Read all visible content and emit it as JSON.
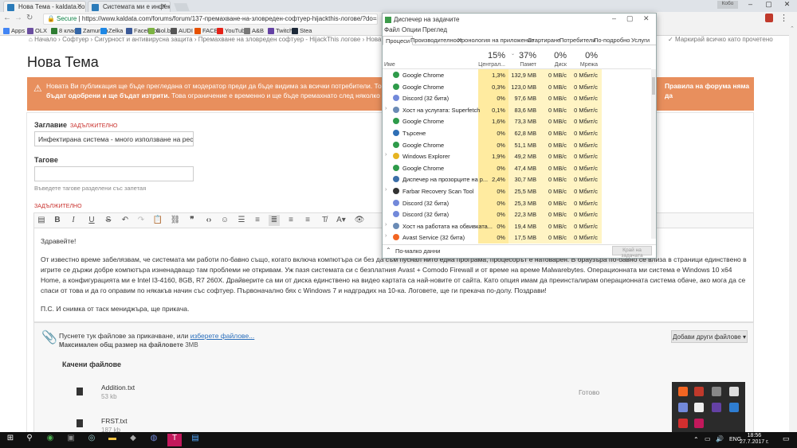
{
  "browser": {
    "tabs": [
      {
        "label": "Нова Тема - kaldata.com"
      },
      {
        "label": "Системата ми е инфекти"
      }
    ],
    "user": "Кобо",
    "secure_label": "Secure",
    "url": "https://www.kaldata.com/forums/forum/137-премахване-на-зловреден-софтуер-hijackthis-логове/?do=add",
    "bookmarks": [
      "Apps",
      "OLX",
      "8 клас",
      "Zamunda",
      "Zelka",
      "Facebook",
      "Gol.bg",
      "AUDI",
      "FACEIT",
      "YouTube",
      "A&B",
      "Twitch",
      "Stea"
    ],
    "bookmark_colors": [
      "#4285f4",
      "#6a4ea0",
      "#2e7d32",
      "#3466a8",
      "#1e88e5",
      "#3b5998",
      "#7cb342",
      "#555555",
      "#e65100",
      "#e62117",
      "#777777",
      "#6441a4",
      "#1b2838"
    ]
  },
  "page": {
    "breadcrumb": [
      "Начало",
      "Софтуер",
      "Сигурност и антивирусна защита",
      "Премахване на зловреден софтуер - HijackThis логове",
      "Нова тема"
    ],
    "mark_all_read": "Маркирай всичко като прочетено",
    "title": "Нова Тема",
    "alert_text": "Новата Ви публикация ще бъде прегледана от модератор преди да бъде видима за всички потребители. Това може да",
    "alert_bold_right": "Правила на форума няма да",
    "alert_bold": "бъдат одобрени и ще бъдат изтрити.",
    "alert_rest": "Това ограничение е временно и ще бъде премахнато след няколко одобрени ваш",
    "title_label": "Заглавие",
    "required": "ЗАДЪЛЖИТЕЛНО",
    "title_value": "Инфектирана система - много използване на ресурс",
    "tags_label": "Тагове",
    "tags_hint": "Въведете тагове разделени със запетая",
    "required2": "ЗАДЪЛЖИТЕЛНО",
    "p1": "Здравейте!",
    "p2": "От известно време забелязвам, че системата ми работи по-бавно същo, когато включа компютъра си без да съм пуснал нито една програма, процесорът е натоварен. В браузъра по-бавно се влиза в страници единствено в игрите се държи добре компютъра изненадващо там проблеми не откривам. Уж пазя системата си с безплатния Avast + Comodo Firewall и от време на време Malwarebytes. Операционната ми система е Windows 10 x64 Home, а конфигурацията ми е Intel I3-4160, 8GB,  R7 260X. Драйверите са ми от диска единствено на видео картата са най-новите от сайта. Като опция имам да преинсталирам операционната система обаче, ако мога да се спаси от това и да го оправим по някакъв начин със софтуер. Първоначално бях с Windows 7 и надградих на 10-ка. Логовете, ще ги прекача по-долу. Поздрави!",
    "p3": "П.С. И снимка от таск мениджъра, ще прикача.",
    "attach_text": "Пуснете тук файлове за прикачване, или",
    "attach_link": "изберете файлове...",
    "attach_size_label": "Максимален общ размер на файловете",
    "attach_size": "3MB",
    "more_files": "Добави други файлове",
    "uploaded": "Качени файлове",
    "files": [
      {
        "name": "Addition.txt",
        "size": "53 kb",
        "status": "Готово"
      },
      {
        "name": "FRST.txt",
        "size": "187 kb",
        "status": ""
      }
    ]
  },
  "taskmgr": {
    "title": "Диспечер на задачите",
    "menu": [
      "Файл",
      "Опции",
      "Преглед"
    ],
    "tabs": [
      "Процеси",
      "Производителност",
      "Хронология на приложение",
      "Стартиране",
      "Потребители",
      "По-подробно",
      "Услуги"
    ],
    "col_name": "Име",
    "cpu_pct": "15%",
    "mem_pct": "37%",
    "disk_pct": "0%",
    "net_pct": "0%",
    "col_cpu": "Централ...",
    "col_mem": "Памет",
    "col_disk": "Диск",
    "col_net": "Мрежа",
    "rows": [
      {
        "name": "Google Chrome",
        "cpu": "1,3%",
        "mem": "132,9 MB",
        "disk": "0 MB/c",
        "net": "0 Mбит/с",
        "color": "#2e9b4a"
      },
      {
        "name": "Google Chrome",
        "cpu": "0,3%",
        "mem": "123,0 MB",
        "disk": "0 MB/c",
        "net": "0 Mбит/с",
        "color": "#2e9b4a"
      },
      {
        "name": "Discord (32 бита)",
        "cpu": "0%",
        "mem": "97,6 MB",
        "disk": "0 MB/c",
        "net": "0 Mбит/с",
        "color": "#7289da"
      },
      {
        "name": "Хост на услугата: Superfetch",
        "cpu": "0,1%",
        "mem": "83,6 MB",
        "disk": "0 MB/c",
        "net": "0 Mбит/с",
        "color": "#6b8bb5"
      },
      {
        "name": "Google Chrome",
        "cpu": "1,6%",
        "mem": "73,3 MB",
        "disk": "0 MB/c",
        "net": "0 Mбит/с",
        "color": "#2e9b4a"
      },
      {
        "name": "Търсене",
        "cpu": "0%",
        "mem": "62,8 MB",
        "disk": "0 MB/c",
        "net": "0 Mбит/с",
        "color": "#2f6fb5"
      },
      {
        "name": "Google Chrome",
        "cpu": "0%",
        "mem": "51,1 MB",
        "disk": "0 MB/c",
        "net": "0 Mбит/с",
        "color": "#2e9b4a"
      },
      {
        "name": "Windows Explorer",
        "cpu": "1,9%",
        "mem": "49,2 MB",
        "disk": "0 MB/c",
        "net": "0 Mбит/с",
        "color": "#e6b422"
      },
      {
        "name": "Google Chrome",
        "cpu": "0%",
        "mem": "47,4 MB",
        "disk": "0 MB/c",
        "net": "0 Mбит/с",
        "color": "#2e9b4a"
      },
      {
        "name": "Диспечер на прозорците на р...",
        "cpu": "2,4%",
        "mem": "30,7 MB",
        "disk": "0 MB/c",
        "net": "0 Mбит/с",
        "color": "#3b6ea8"
      },
      {
        "name": "Farbar Recovery Scan Tool",
        "cpu": "0%",
        "mem": "25,5 MB",
        "disk": "0 MB/c",
        "net": "0 Mбит/с",
        "color": "#333333"
      },
      {
        "name": "Discord (32 бита)",
        "cpu": "0%",
        "mem": "25,3 MB",
        "disk": "0 MB/c",
        "net": "0 Mбит/с",
        "color": "#7289da"
      },
      {
        "name": "Discord (32 бита)",
        "cpu": "0%",
        "mem": "22,3 MB",
        "disk": "0 MB/c",
        "net": "0 Mбит/с",
        "color": "#7289da"
      },
      {
        "name": "Хост на работата на обвивката...",
        "cpu": "0%",
        "mem": "19,4 MB",
        "disk": "0 MB/c",
        "net": "0 Mбит/с",
        "color": "#6b8bb5"
      },
      {
        "name": "Avast Service (32 бита)",
        "cpu": "0%",
        "mem": "17,5 MB",
        "disk": "0 MB/c",
        "net": "0 Mбит/с",
        "color": "#f26522"
      }
    ],
    "less_details": "По-малко данни",
    "end_task": "Край на задачата"
  },
  "taskbar": {
    "lang": "ENG",
    "time": "18:56",
    "date": "27.7.2017 г."
  }
}
